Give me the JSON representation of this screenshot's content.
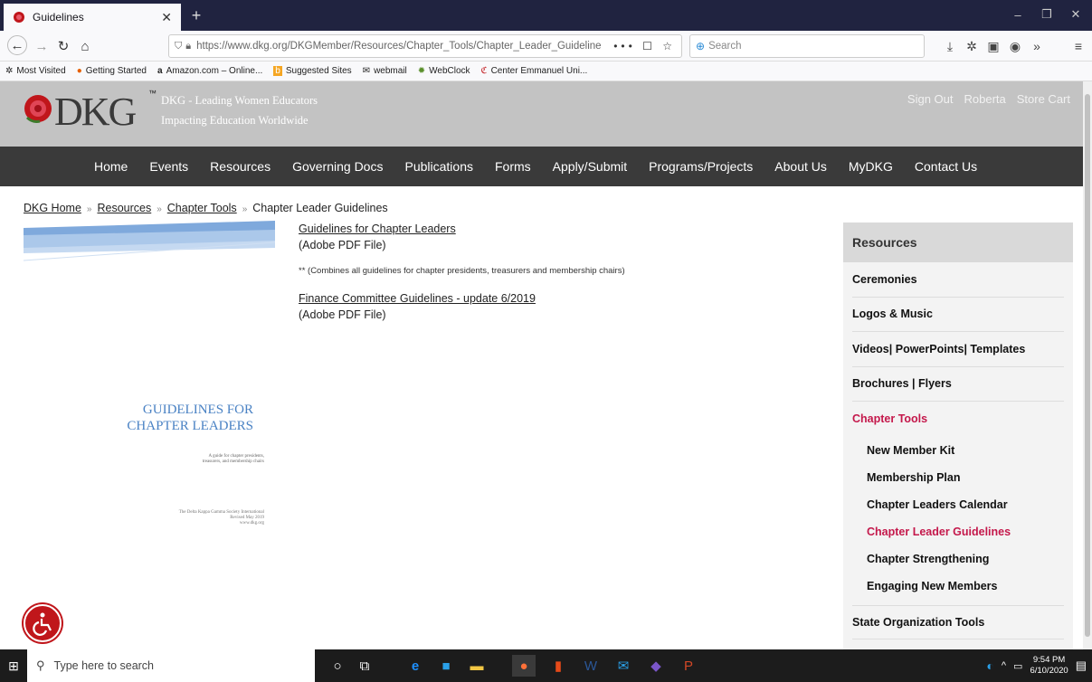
{
  "browser": {
    "tab_title": "Guidelines",
    "url": "https://www.dkg.org/DKGMember/Resources/Chapter_Tools/Chapter_Leader_Guideline",
    "url_actions": "••• ☐ ☆",
    "search_placeholder": "Search",
    "bookmarks": [
      {
        "label": "Most Visited",
        "icon": "gear-icon"
      },
      {
        "label": "Getting Started",
        "icon": "firefox-icon"
      },
      {
        "label": "Amazon.com – Online...",
        "icon": "amazon-icon"
      },
      {
        "label": "Suggested Sites",
        "icon": "bing-icon"
      },
      {
        "label": "webmail",
        "icon": "mail-icon"
      },
      {
        "label": "WebClock",
        "icon": "clock-icon"
      },
      {
        "label": "Center Emmanuel Uni...",
        "icon": "church-icon"
      }
    ]
  },
  "header": {
    "logo_text": "DKG",
    "tm": "™",
    "tagline1": "DKG - Leading Women Educators",
    "tagline2": "Impacting Education Worldwide",
    "user_links": [
      "Sign Out",
      "Roberta",
      "Store Cart"
    ]
  },
  "nav": [
    "Home",
    "Events",
    "Resources",
    "Governing Docs",
    "Publications",
    "Forms",
    "Apply/Submit",
    "Programs/Projects",
    "About Us",
    "MyDKG",
    "Contact Us"
  ],
  "breadcrumb": {
    "items": [
      "DKG Home",
      "Resources",
      "Chapter Tools"
    ],
    "current": "Chapter Leader Guidelines",
    "sep": "»"
  },
  "cover": {
    "title_line1": "GUIDELINES FOR",
    "title_line2": "CHAPTER LEADERS",
    "subtitle_line1": "A guide for chapter presidents,",
    "subtitle_line2": "treasurers, and membership chairs",
    "foot_line1": "The Delta Kappa Gamma Society International",
    "foot_line2": "Revised May 2019",
    "foot_line3": "www.dkg.org"
  },
  "documents": {
    "doc1_title": "Guidelines for Chapter Leaders",
    "doc1_type": "(Adobe PDF File)",
    "doc1_note": "** (Combines all guidelines for chapter presidents, treasurers and membership chairs)",
    "doc2_title": "Finance Committee Guidelines - update 6/2019",
    "doc2_type": "(Adobe PDF File)"
  },
  "sidebar": {
    "heading": "Resources",
    "items_top": [
      "Ceremonies",
      "Logos & Music",
      "Videos| PowerPoints| Templates",
      "Brochures | Flyers"
    ],
    "active_section": "Chapter Tools",
    "sub_items": [
      "New Member Kit",
      "Membership Plan",
      "Chapter Leaders Calendar",
      "Chapter Leader Guidelines",
      "Chapter Strengthening",
      "Engaging New Members"
    ],
    "active_sub": "Chapter Leader Guidelines",
    "items_bottom": [
      "State Organization Tools"
    ]
  },
  "taskbar": {
    "search_placeholder": "Type here to search",
    "time": "9:54 PM",
    "date": "6/10/2020"
  },
  "colors": {
    "nav_bg": "#3a3a3a",
    "header_bg": "#c3c3c3",
    "accent": "#c4184b",
    "cover_blue": "#4a82c4"
  }
}
